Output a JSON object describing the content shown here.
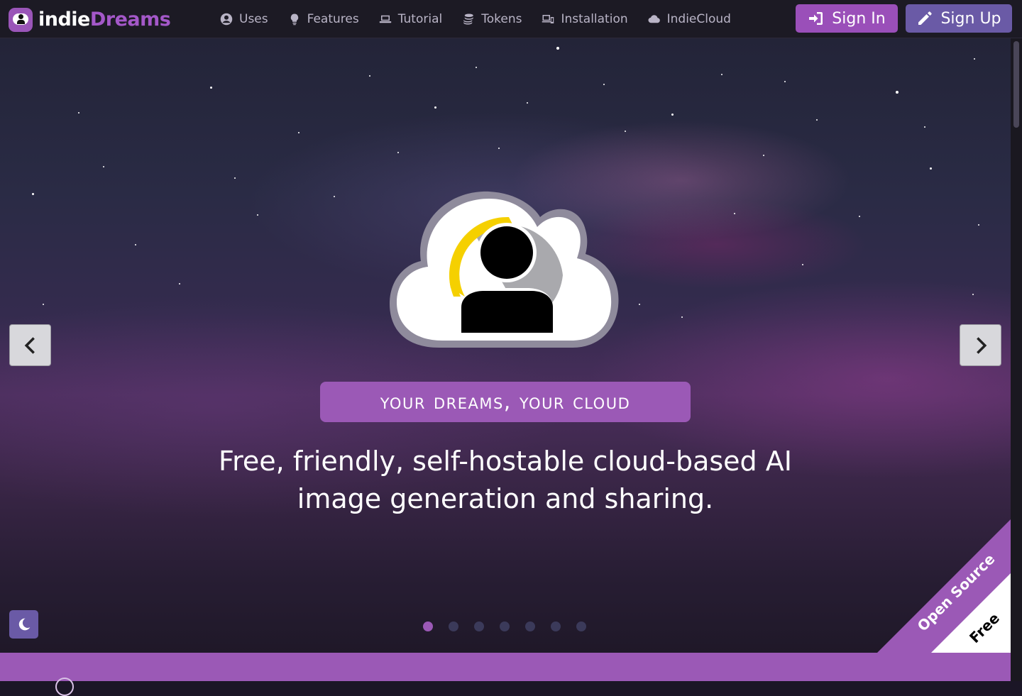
{
  "brand": {
    "part1": "indie",
    "part2": "Dreams",
    "accent": "#9b59b6"
  },
  "nav": [
    {
      "label": "Uses",
      "icon": "user-circle-icon"
    },
    {
      "label": "Features",
      "icon": "lightbulb-icon"
    },
    {
      "label": "Tutorial",
      "icon": "laptop-icon"
    },
    {
      "label": "Tokens",
      "icon": "coins-icon"
    },
    {
      "label": "Installation",
      "icon": "devices-icon"
    },
    {
      "label": "IndieCloud",
      "icon": "cloud-icon"
    }
  ],
  "auth": {
    "sign_in": "Sign In",
    "sign_up": "Sign Up"
  },
  "hero": {
    "tagline": "Your Dreams, Your Cloud",
    "description": "Free, friendly, self-hostable cloud-based AI image generation and sharing.",
    "slides_total": 7,
    "active_slide": 1
  },
  "ribbon": {
    "primary": "Open Source",
    "secondary": "Free"
  },
  "colors": {
    "nav_bg": "#1c1a24",
    "sign_in_bg": "#9a4fb9",
    "sign_up_bg": "#6a5aa6"
  }
}
